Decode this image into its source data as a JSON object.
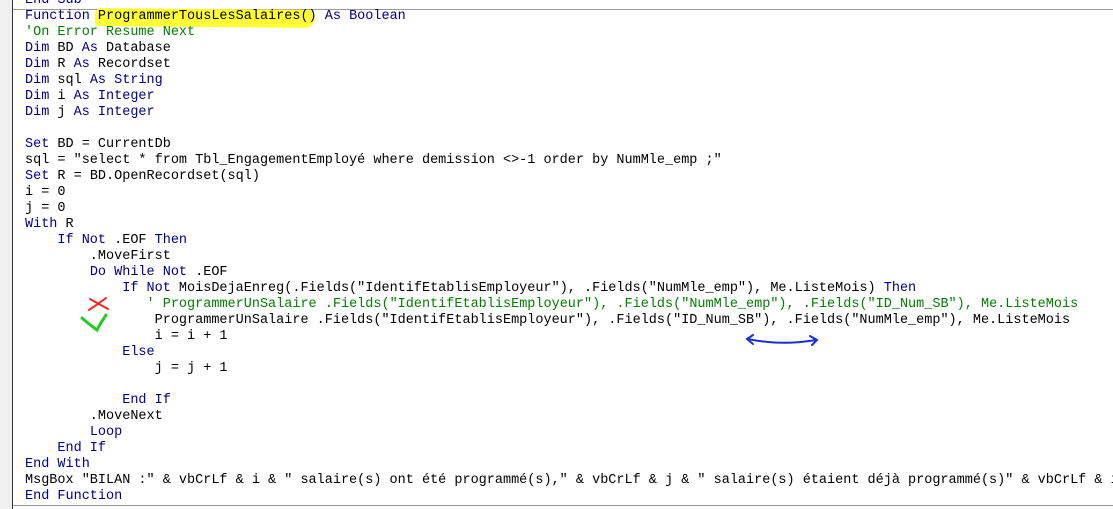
{
  "editor": {
    "colors": {
      "keyword": "#00007f",
      "comment": "#007f00",
      "text": "#000000",
      "highlight": "#ffff33",
      "annotation_x": "#ff2020",
      "annotation_check": "#22cc22",
      "annotation_arrow": "#1a2ed8"
    },
    "annotation_icons": [
      "highlight-marker",
      "red-x-icon",
      "green-check-icon",
      "blue-swap-arrow-icon"
    ],
    "lines": [
      [
        [
          "k",
          "End Sub"
        ]
      ],
      [
        [
          "k",
          "Function"
        ],
        [
          "t",
          " ProgrammerTousLesSalaires() "
        ],
        [
          "k",
          "As Boolean"
        ]
      ],
      [
        [
          "c",
          "'On Error Resume Next"
        ]
      ],
      [
        [
          "k",
          "Dim"
        ],
        [
          "t",
          " BD "
        ],
        [
          "k",
          "As"
        ],
        [
          "t",
          " Database"
        ]
      ],
      [
        [
          "k",
          "Dim"
        ],
        [
          "t",
          " R "
        ],
        [
          "k",
          "As"
        ],
        [
          "t",
          " Recordset"
        ]
      ],
      [
        [
          "k",
          "Dim"
        ],
        [
          "t",
          " sql "
        ],
        [
          "k",
          "As String"
        ]
      ],
      [
        [
          "k",
          "Dim"
        ],
        [
          "t",
          " i "
        ],
        [
          "k",
          "As Integer"
        ]
      ],
      [
        [
          "k",
          "Dim"
        ],
        [
          "t",
          " j "
        ],
        [
          "k",
          "As Integer"
        ]
      ],
      [],
      [
        [
          "k",
          "Set"
        ],
        [
          "t",
          " BD = CurrentDb"
        ]
      ],
      [
        [
          "t",
          "sql = \"select * from Tbl_EngagementEmployé where demission <>-1 order by NumMle_emp ;\""
        ]
      ],
      [
        [
          "k",
          "Set"
        ],
        [
          "t",
          " R = BD.OpenRecordset(sql)"
        ]
      ],
      [
        [
          "t",
          "i = 0"
        ]
      ],
      [
        [
          "t",
          "j = 0"
        ]
      ],
      [
        [
          "k",
          "With"
        ],
        [
          "t",
          " R"
        ]
      ],
      [
        [
          "t",
          "    "
        ],
        [
          "k",
          "If Not"
        ],
        [
          "t",
          " .EOF "
        ],
        [
          "k",
          "Then"
        ]
      ],
      [
        [
          "t",
          "        .MoveFirst"
        ]
      ],
      [
        [
          "t",
          "        "
        ],
        [
          "k",
          "Do While Not"
        ],
        [
          "t",
          " .EOF"
        ]
      ],
      [
        [
          "t",
          "            "
        ],
        [
          "k",
          "If Not"
        ],
        [
          "t",
          " MoisDejaEnreg(.Fields(\"IdentifEtablisEmployeur\"), .Fields(\"NumMle_emp\"), Me.ListeMois) "
        ],
        [
          "k",
          "Then"
        ]
      ],
      [
        [
          "t",
          "               "
        ],
        [
          "c",
          "' ProgrammerUnSalaire .Fields(\"IdentifEtablisEmployeur\"), .Fields(\"NumMle_emp\"), .Fields(\"ID_Num_SB\"), Me.ListeMois"
        ]
      ],
      [
        [
          "t",
          "                ProgrammerUnSalaire .Fields(\"IdentifEtablisEmployeur\"), .Fields(\"ID_Num_SB\"), .Fields(\"NumMle_emp\"), Me.ListeMois"
        ]
      ],
      [
        [
          "t",
          "                i = i + 1"
        ]
      ],
      [
        [
          "t",
          "            "
        ],
        [
          "k",
          "Else"
        ]
      ],
      [
        [
          "t",
          "                j = j + 1"
        ]
      ],
      [],
      [
        [
          "t",
          "            "
        ],
        [
          "k",
          "End If"
        ]
      ],
      [
        [
          "t",
          "        .MoveNext"
        ]
      ],
      [
        [
          "t",
          "        "
        ],
        [
          "k",
          "Loop"
        ]
      ],
      [
        [
          "t",
          "    "
        ],
        [
          "k",
          "End If"
        ]
      ],
      [
        [
          "k",
          "End With"
        ]
      ],
      [
        [
          "t",
          "MsgBox \"BILAN :\" & vbCrLf & i & \" salaire(s) ont été programmé(s),\" & vbCrLf & j & \" salaire(s) étaient déjà programmé(s)\" & vbCrLf & i"
        ]
      ],
      [
        [
          "k",
          "End Function"
        ]
      ]
    ]
  }
}
